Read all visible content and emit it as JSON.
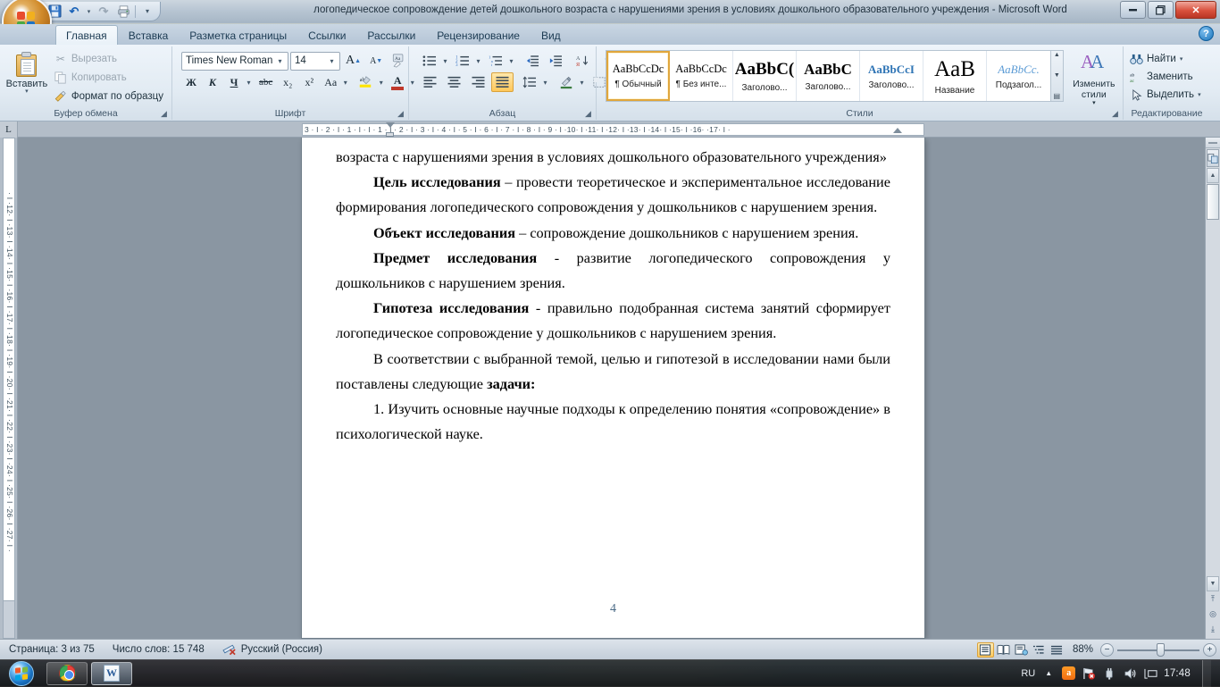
{
  "window": {
    "title": "логопедическое сопровождение детей дошкольного возраста с нарушениями зрения в условиях дошкольного образовательного учреждения - Microsoft Word",
    "minimize": "—",
    "restore": "❐",
    "close": "✕",
    "help": "?"
  },
  "quick_access": {
    "save": "💾",
    "undo": "↶",
    "redo": "↷",
    "print": "🖨",
    "customize": "▾"
  },
  "tabs": [
    {
      "label": "Главная",
      "active": true
    },
    {
      "label": "Вставка",
      "active": false
    },
    {
      "label": "Разметка страницы",
      "active": false
    },
    {
      "label": "Ссылки",
      "active": false
    },
    {
      "label": "Рассылки",
      "active": false
    },
    {
      "label": "Рецензирование",
      "active": false
    },
    {
      "label": "Вид",
      "active": false
    }
  ],
  "ribbon": {
    "clipboard": {
      "title": "Буфер обмена",
      "paste": "Вставить",
      "paste_arrow": "▾",
      "cut": "Вырезать",
      "copy": "Копировать",
      "format_painter": "Формат по образцу",
      "launcher": "◢"
    },
    "font": {
      "title": "Шрифт",
      "font_name": "Times New Roman",
      "font_size": "14",
      "grow": "A",
      "shrink": "A",
      "clear_format": "Aa",
      "bold": "Ж",
      "italic": "К",
      "underline": "Ч",
      "strikethrough": "abc",
      "subscript": "x₂",
      "superscript": "x²",
      "change_case": "Aa",
      "highlight": "ab",
      "font_color": "A",
      "arrow": "▾",
      "launcher": "◢"
    },
    "paragraph": {
      "title": "Абзац",
      "bullets": "bullet-list",
      "numbering": "numbered-list",
      "multilevel": "multilevel-list",
      "decrease_indent": "◄≡",
      "increase_indent": "≡►",
      "sort": "A↓",
      "show_marks": "¶",
      "align_left": "align-left",
      "align_center": "align-center",
      "align_right": "align-right",
      "align_justify": "align-justify",
      "line_spacing": "↕≡",
      "shading": "shading",
      "borders": "borders",
      "arrow": "▾",
      "launcher": "◢",
      "active_alignment": "justify"
    },
    "styles": {
      "title": "Стили",
      "items": [
        {
          "preview": "AaBbCcDc",
          "name": "¶ Обычный",
          "selected": true,
          "style": "normal"
        },
        {
          "preview": "AaBbCcDc",
          "name": "¶ Без инте...",
          "selected": false,
          "style": "normal"
        },
        {
          "preview": "AaBbC(",
          "name": "Заголово...",
          "selected": false,
          "style": "h1"
        },
        {
          "preview": "AaBbC",
          "name": "Заголово...",
          "selected": false,
          "style": "h2"
        },
        {
          "preview": "AaBbCcI",
          "name": "Заголово...",
          "selected": false,
          "style": "h3"
        },
        {
          "preview": "AaB",
          "name": "Название",
          "selected": false,
          "style": "title"
        },
        {
          "preview": "AaBbCc.",
          "name": "Подзагол...",
          "selected": false,
          "style": "subtitle"
        }
      ],
      "scroll_up": "▲",
      "scroll_down": "▼",
      "more": "▤",
      "change_styles": "Изменить стили",
      "change_styles_arrow": "▾",
      "change_styles_icon": "AA",
      "launcher": "◢"
    },
    "editing": {
      "title": "Редактирование",
      "find": "Найти",
      "replace": "Заменить",
      "select": "Выделить",
      "arrow": "▾"
    }
  },
  "ruler": {
    "tab_selector": "L",
    "horizontal": "3 · I · 2 · I · 1 · I      · I · 1 · I · 2 · I · 3 · I · 4 · I · 5 · I · 6 · I · 7 · I · 8 · I · 9 · I ·10· I ·11· I ·12· I ·13· I ·14· I ·15· I ·16·  ·17· I ·",
    "vertical": "· I ·12· I ·13· I ·14· I ·15· I ·16· I ·17· I ·18· I ·19· I ·20· I ·21· I ·22· I ·23· I ·24· I ·25· I ·26· I ·27· I ·"
  },
  "document": {
    "paragraphs": [
      {
        "type": "plain",
        "runs": [
          {
            "text": "возраста с нарушениями зрения в условиях дошкольного образовательного учреждения»",
            "bold": false
          }
        ]
      },
      {
        "type": "indent",
        "runs": [
          {
            "text": "Цель исследования",
            "bold": true
          },
          {
            "text": " – провести теоретическое и экспериментальное исследование формирования логопедического сопровождения у дошкольников с нарушением зрения.",
            "bold": false
          }
        ]
      },
      {
        "type": "indent",
        "runs": [
          {
            "text": "Объект исследования",
            "bold": true
          },
          {
            "text": " – сопровождение  дошкольников с нарушением зрения.",
            "bold": false
          }
        ]
      },
      {
        "type": "indent",
        "runs": [
          {
            "text": "Предмет исследования",
            "bold": true
          },
          {
            "text": " - развитие логопедического сопровождения у дошкольников с нарушением зрения.",
            "bold": false
          }
        ]
      },
      {
        "type": "indent",
        "runs": [
          {
            "text": "Гипотеза исследования",
            "bold": true
          },
          {
            "text": " - правильно подобранная система занятий сформирует логопедическое сопровождение у  дошкольников с нарушением зрения.",
            "bold": false
          }
        ]
      },
      {
        "type": "indent",
        "runs": [
          {
            "text": "В соответствии с выбранной темой, целью и гипотезой в исследовании нами были поставлены следующие ",
            "bold": false
          },
          {
            "text": "задачи:",
            "bold": true
          }
        ]
      },
      {
        "type": "indent",
        "runs": [
          {
            "text": "1.       Изучить основные научные подходы к определению понятия «сопровождение» в психологической науке.",
            "bold": false
          }
        ]
      }
    ],
    "footer_page_number": "4"
  },
  "scrollbar": {
    "split": "split-handle",
    "browse_object": "◉",
    "up": "▲",
    "down": "▼",
    "prev_page": "⤒",
    "select_object": "◎",
    "next_page": "⤓"
  },
  "statusbar": {
    "page": "Страница: 3 из 75",
    "words": "Число слов: 15 748",
    "proofing_icon": "spelling-errors-icon",
    "language": "Русский (Россия)",
    "views": [
      {
        "name": "print-layout",
        "glyph": "▤",
        "active": true
      },
      {
        "name": "full-screen-reading",
        "glyph": "▥",
        "active": false
      },
      {
        "name": "web-layout",
        "glyph": "▣",
        "active": false
      },
      {
        "name": "outline",
        "glyph": "▦",
        "active": false
      },
      {
        "name": "draft",
        "glyph": "▤",
        "active": false
      }
    ],
    "zoom_level": "88%",
    "zoom_out": "−",
    "zoom_in": "+"
  },
  "taskbar": {
    "start": "start-orb",
    "items": [
      {
        "name": "chrome",
        "active": false
      },
      {
        "name": "word",
        "active": true,
        "glyph": "W"
      }
    ],
    "tray": {
      "language": "RU",
      "show_hidden": "▲",
      "avast": "a",
      "network_error": "⚑",
      "power": "🔌",
      "volume": "🔊",
      "network": "🖥",
      "clock": "17:48"
    }
  }
}
